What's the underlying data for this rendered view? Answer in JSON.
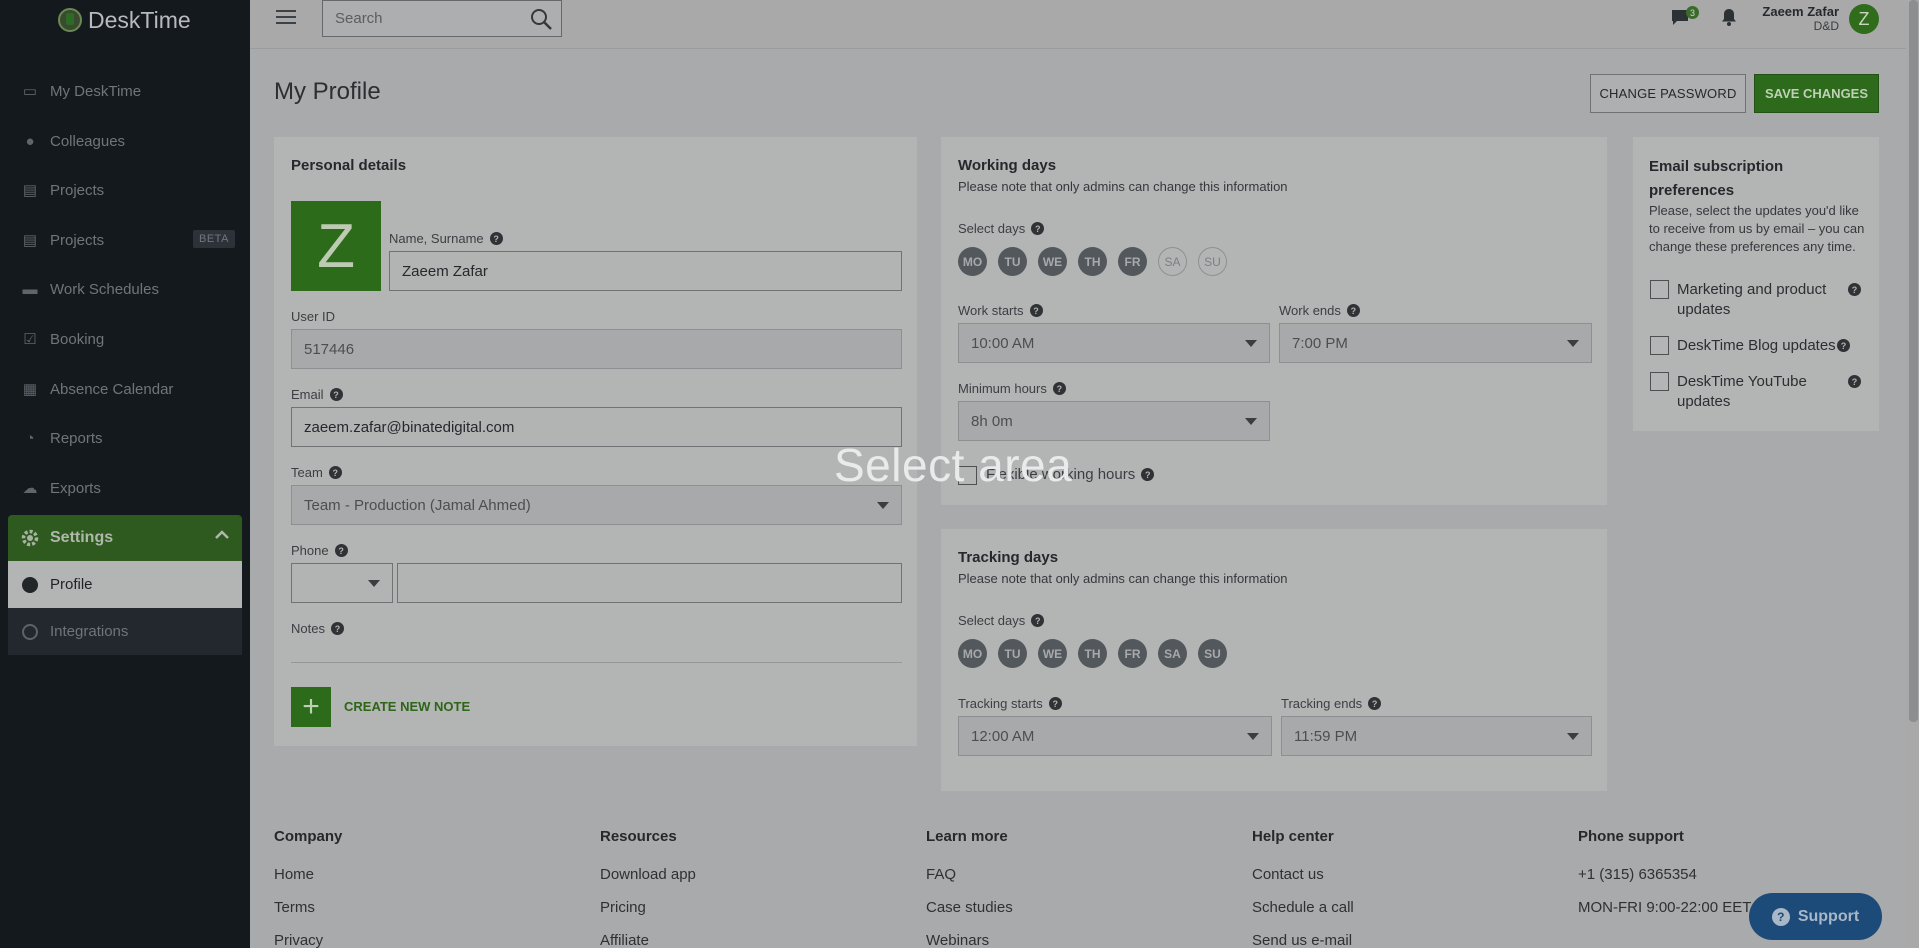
{
  "brand": {
    "name": "DeskTime"
  },
  "sidebar": {
    "items": [
      {
        "label": "My DeskTime",
        "icon": "monitor-icon"
      },
      {
        "label": "Colleagues",
        "icon": "user-icon"
      },
      {
        "label": "Projects",
        "icon": "folder-icon"
      },
      {
        "label": "Projects",
        "icon": "folder-icon",
        "badge": "BETA"
      },
      {
        "label": "Work Schedules",
        "icon": "briefcase-icon"
      },
      {
        "label": "Booking",
        "icon": "calendar-check-icon"
      },
      {
        "label": "Absence Calendar",
        "icon": "calendar-icon"
      },
      {
        "label": "Reports",
        "icon": "pie-chart-icon"
      },
      {
        "label": "Exports",
        "icon": "cloud-icon"
      }
    ],
    "settings": {
      "label": "Settings",
      "icon": "gear-icon"
    },
    "subitems": [
      {
        "label": "Profile",
        "active": true
      },
      {
        "label": "Integrations",
        "active": false
      }
    ]
  },
  "header": {
    "search_placeholder": "Search",
    "messages_count": "3",
    "user_name": "Zaeem Zafar",
    "company": "D&D",
    "avatar_letter": "Z"
  },
  "page": {
    "title": "My Profile",
    "change_password": "CHANGE PASSWORD",
    "save_changes": "SAVE CHANGES"
  },
  "personal": {
    "title": "Personal details",
    "avatar_letter": "Z",
    "name_label": "Name, Surname",
    "name_value": "Zaeem Zafar",
    "userid_label": "User ID",
    "userid_value": "517446",
    "email_label": "Email",
    "email_value": "zaeem.zafar@binatedigital.com",
    "team_label": "Team",
    "team_value": "Team - Production (Jamal Ahmed)",
    "phone_label": "Phone",
    "phone_code": "",
    "phone_value": "",
    "notes_label": "Notes",
    "create_note": "CREATE NEW NOTE"
  },
  "working": {
    "title": "Working days",
    "note": "Please note that only admins can change this information",
    "select_days_label": "Select days",
    "days": [
      {
        "label": "MO",
        "on": true
      },
      {
        "label": "TU",
        "on": true
      },
      {
        "label": "WE",
        "on": true
      },
      {
        "label": "TH",
        "on": true
      },
      {
        "label": "FR",
        "on": true
      },
      {
        "label": "SA",
        "on": false
      },
      {
        "label": "SU",
        "on": false
      }
    ],
    "starts_label": "Work starts",
    "starts_value": "10:00 AM",
    "ends_label": "Work ends",
    "ends_value": "7:00 PM",
    "min_label": "Minimum hours",
    "min_value": "8h 0m",
    "flex_label": "Flexible working hours"
  },
  "tracking": {
    "title": "Tracking days",
    "note": "Please note that only admins can change this information",
    "select_days_label": "Select days",
    "days": [
      {
        "label": "MO",
        "on": true
      },
      {
        "label": "TU",
        "on": true
      },
      {
        "label": "WE",
        "on": true
      },
      {
        "label": "TH",
        "on": true
      },
      {
        "label": "FR",
        "on": true
      },
      {
        "label": "SA",
        "on": true
      },
      {
        "label": "SU",
        "on": true
      }
    ],
    "starts_label": "Tracking starts",
    "starts_value": "12:00 AM",
    "ends_label": "Tracking ends",
    "ends_value": "11:59 PM"
  },
  "email_prefs": {
    "title": "Email subscription preferences",
    "description": "Please, select the updates you'd like to receive from us by email – you can change these preferences any time.",
    "options": [
      {
        "label": "Marketing and product updates",
        "checked": false
      },
      {
        "label": "DeskTime Blog updates",
        "checked": false
      },
      {
        "label": "DeskTime YouTube updates",
        "checked": false
      }
    ]
  },
  "overlay": {
    "text": "Select area"
  },
  "footer": {
    "columns": [
      {
        "heading": "Company",
        "links": [
          "Home",
          "Terms",
          "Privacy"
        ]
      },
      {
        "heading": "Resources",
        "links": [
          "Download app",
          "Pricing",
          "Affiliate"
        ]
      },
      {
        "heading": "Learn more",
        "links": [
          "FAQ",
          "Case studies",
          "Webinars"
        ]
      },
      {
        "heading": "Help center",
        "links": [
          "Contact us",
          "Schedule a call",
          "Send us e-mail"
        ]
      },
      {
        "heading": "Phone support",
        "links": [
          "+1 (315) 6365354",
          "MON-FRI 9:00-22:00 EET"
        ]
      }
    ],
    "support_label": "Support"
  },
  "colors": {
    "accent": "#2c6b1a",
    "sidebar": "#14191e",
    "overlay_dim": "#a9aaab"
  }
}
